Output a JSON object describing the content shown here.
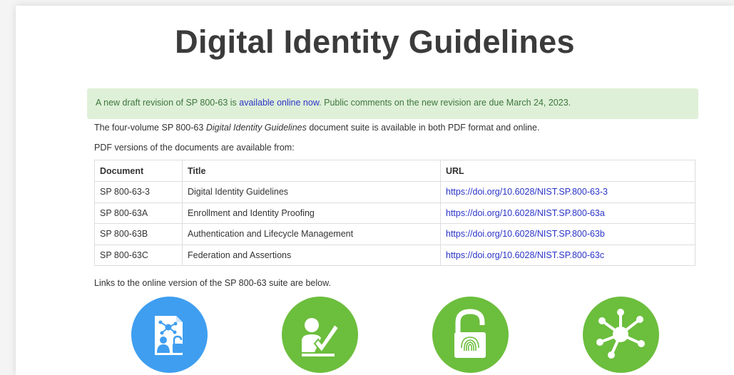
{
  "title": "Digital Identity Guidelines",
  "alert": {
    "prefix": "A new draft revision of SP 800-63 is ",
    "link": "available online now",
    "suffix": ". Public comments on the new revision are due March 24, 2023."
  },
  "intro": {
    "prefix": "The four-volume SP 800-63 ",
    "emphasis": "Digital Identity Guidelines",
    "suffix": " document suite is available in both PDF format and online."
  },
  "pdf_note": "PDF versions of the documents are available from:",
  "table": {
    "headers": [
      "Document",
      "Title",
      "URL"
    ],
    "rows": [
      {
        "doc": "SP 800-63-3",
        "title": "Digital Identity Guidelines",
        "url": "https://doi.org/10.6028/NIST.SP.800-63-3"
      },
      {
        "doc": "SP 800-63A",
        "title": "Enrollment and Identity Proofing",
        "url": "https://doi.org/10.6028/NIST.SP.800-63a"
      },
      {
        "doc": "SP 800-63B",
        "title": "Authentication and Lifecycle Management",
        "url": "https://doi.org/10.6028/NIST.SP.800-63b"
      },
      {
        "doc": "SP 800-63C",
        "title": "Federation and Assertions",
        "url": "https://doi.org/10.6028/NIST.SP.800-63c"
      }
    ]
  },
  "online_note": "Links to the online version of the SP 800-63 suite are below.",
  "icons": [
    {
      "name": "digital-identity-icon",
      "color": "#3f9ef0"
    },
    {
      "name": "enrollment-checkmark-icon",
      "color": "#6cbe3d"
    },
    {
      "name": "authentication-padlock-fingerprint-icon",
      "color": "#6cbe3d"
    },
    {
      "name": "federation-network-icon",
      "color": "#6cbe3d"
    }
  ],
  "colors": {
    "alert_bg": "#dff0d8",
    "alert_text": "#3c763d",
    "link": "#2a34c7"
  }
}
